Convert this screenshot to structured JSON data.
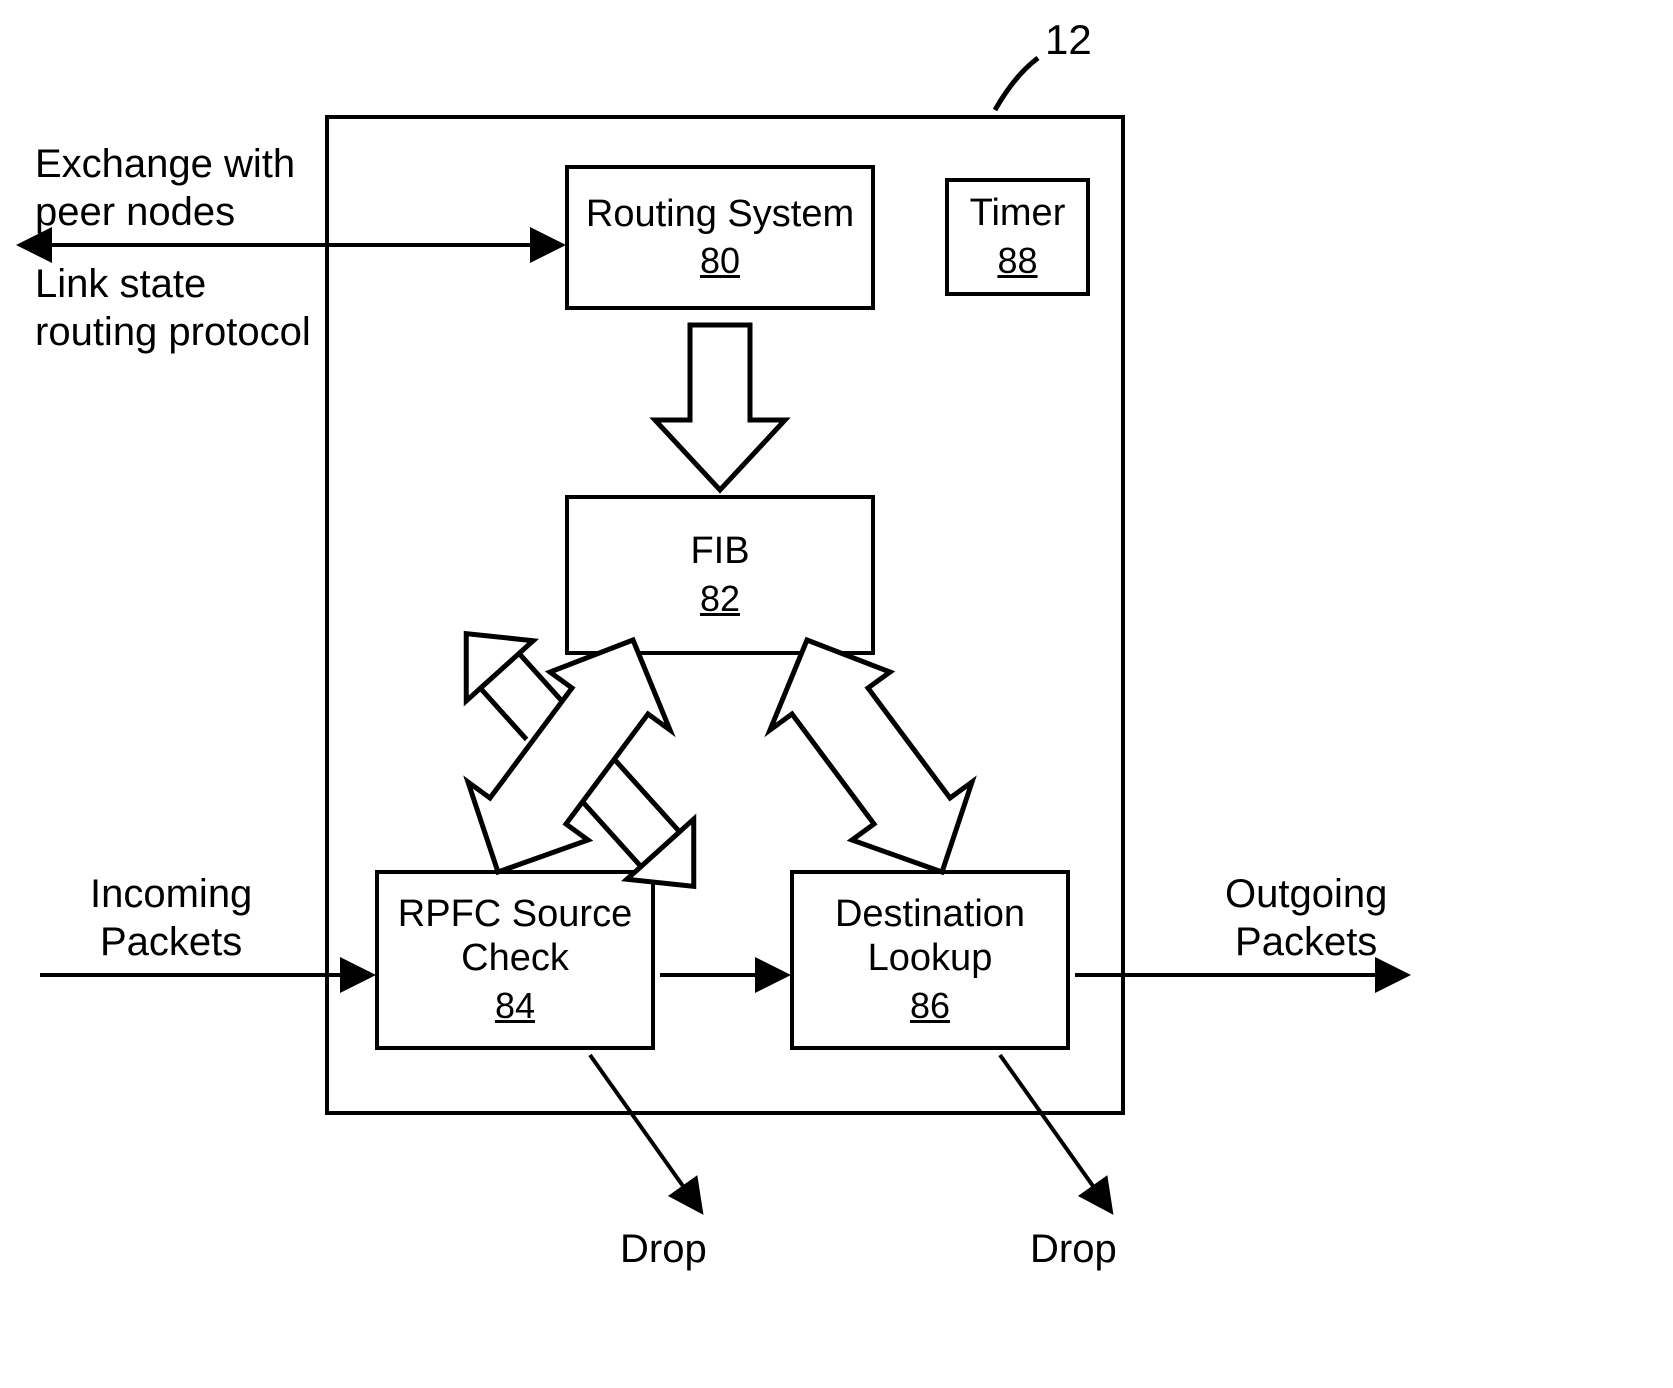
{
  "diagram": {
    "reference_number": "12",
    "outer_box": {},
    "modules": {
      "routing_system": {
        "name": "Routing System",
        "num": "80"
      },
      "timer": {
        "name": "Timer",
        "num": "88"
      },
      "fib": {
        "name": "FIB",
        "num": "82"
      },
      "rpfc": {
        "name": "RPFC Source\nCheck",
        "num": "84"
      },
      "dest_lookup": {
        "name": "Destination\nLookup",
        "num": "86"
      }
    },
    "labels": {
      "exchange_top": "Exchange with\npeer nodes",
      "exchange_bottom": "Link state\nrouting protocol",
      "incoming": "Incoming\nPackets",
      "outgoing": "Outgoing\nPackets",
      "drop1": "Drop",
      "drop2": "Drop"
    }
  }
}
